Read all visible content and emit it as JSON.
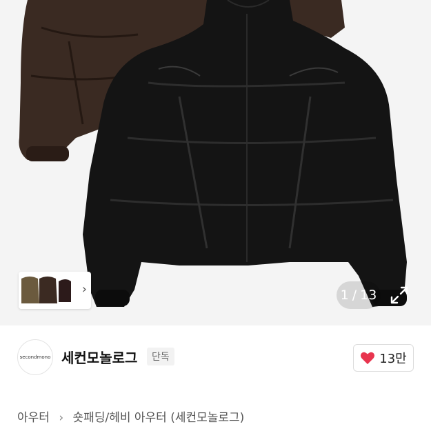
{
  "gallery": {
    "counter_current": "1",
    "counter_separator": "/",
    "counter_total": "13",
    "expand_icon": "expand-icon",
    "thumb_chevron_icon": "chevron-right-icon",
    "background_color": "#f4f4f4"
  },
  "brand": {
    "logo_text": "secondmono",
    "name": "세컨모놀로그",
    "exclusive_badge": "단독"
  },
  "like": {
    "icon": "heart-icon",
    "count": "13만",
    "color": "#e8344e"
  },
  "breadcrumb": {
    "items": [
      "아우터",
      "숏패딩/헤비 아우터 (세컨모놀로그)"
    ],
    "separator_icon": "chevron-right-icon"
  }
}
